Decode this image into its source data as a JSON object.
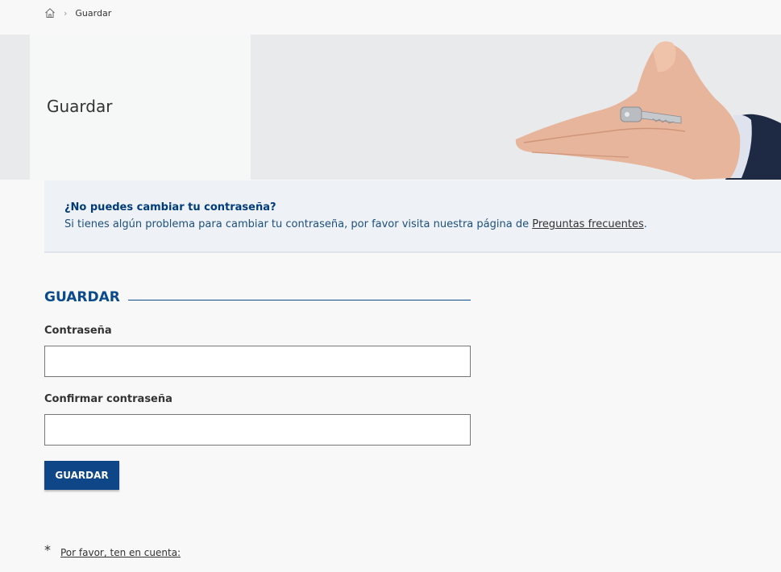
{
  "breadcrumb": {
    "home_icon": "home-icon",
    "separator": "›",
    "current": "Guardar"
  },
  "hero": {
    "title": "Guardar",
    "image": "hand-holding-key"
  },
  "info": {
    "title": "¿No puedes cambiar tu contraseña?",
    "text_before": "Si tienes algún problema para cambiar tu contraseña, por favor visita nuestra página de ",
    "link": "Preguntas frecuentes",
    "text_after": "."
  },
  "form": {
    "heading": "GUARDAR",
    "password_label": "Contraseña",
    "password_value": "",
    "confirm_label": "Confirmar contraseña",
    "confirm_value": "",
    "submit_label": "GUARDAR"
  },
  "note": {
    "marker": "*",
    "link": "Por favor, ten en cuenta:"
  },
  "colors": {
    "primary": "#0f4688",
    "heading": "#0b4a8b",
    "info_bg": "#eef2f7",
    "hero_bg": "#e9eaec"
  }
}
